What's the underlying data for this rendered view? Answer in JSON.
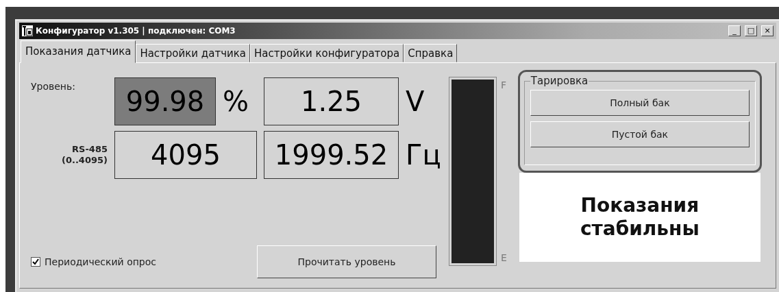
{
  "window": {
    "title": "Конфигуратор v1.305 | подключен: COM3",
    "controls": [
      "_",
      "□",
      "×"
    ]
  },
  "tabs": [
    {
      "label": "Показания датчика",
      "selected": true
    },
    {
      "label": "Настройки датчика",
      "selected": false
    },
    {
      "label": "Настройки конфигуратора",
      "selected": false
    },
    {
      "label": "Справка",
      "selected": false
    }
  ],
  "readings": {
    "level_label": "Уровень:",
    "rs485_label": "RS-485",
    "rs485_range": "(0..4095)",
    "fields": [
      {
        "value": "99.98",
        "unit": "%",
        "highlighted": true
      },
      {
        "value": "1.25",
        "unit": "V",
        "highlighted": false
      },
      {
        "value": "4095",
        "highlighted": false
      },
      {
        "value": "1999.52",
        "unit": "Гц",
        "highlighted": false
      }
    ]
  },
  "periodic_poll": {
    "label": "Периодический опрос",
    "checked": true
  },
  "read_button": "Прочитать уровень",
  "gauge": {
    "level": 1,
    "full_mark": "F",
    "empty_mark": "E"
  },
  "calibration": {
    "title": "Тарировка",
    "buttons": [
      "Полный бак",
      "Пустой бак"
    ]
  },
  "status_message": "Показания стабильны"
}
